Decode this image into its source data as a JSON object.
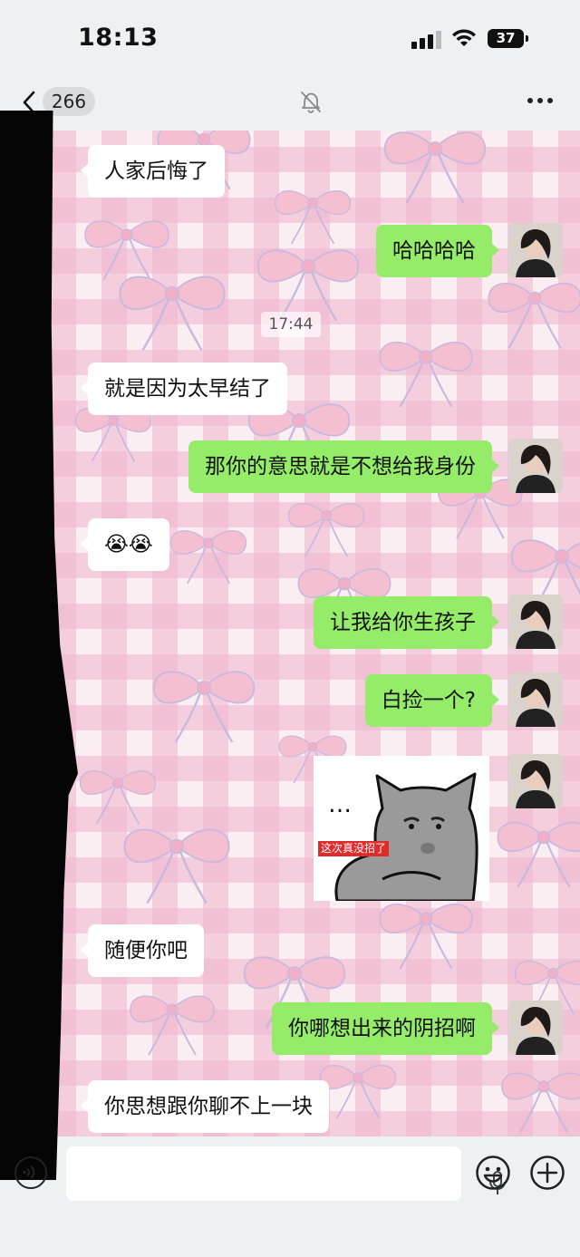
{
  "status_bar": {
    "time": "18:13",
    "battery": "37"
  },
  "nav": {
    "unread_count": "266"
  },
  "messages": [
    {
      "side": "in",
      "text": "人家后悔了"
    },
    {
      "side": "out",
      "text": "哈哈哈哈"
    },
    {
      "type": "time",
      "text": "17:44"
    },
    {
      "side": "in",
      "text": "就是因为太早结了"
    },
    {
      "side": "out",
      "text": "那你的意思就是不想给我身份"
    },
    {
      "side": "in",
      "text": "😭😭"
    },
    {
      "side": "out",
      "text": "让我给你生孩子"
    },
    {
      "side": "out",
      "text": "白捡一个?"
    },
    {
      "side": "out",
      "type": "sticker",
      "dots": "…",
      "caption": "这次真没招了"
    },
    {
      "side": "in",
      "text": "随便你吧"
    },
    {
      "side": "out",
      "text": "你哪想出来的阴招啊"
    },
    {
      "side": "in",
      "text": "你思想跟你聊不上一块"
    }
  ],
  "colors": {
    "outgoing_bubble": "#95ec69",
    "incoming_bubble": "#ffffff",
    "wallpaper_pink": "#f4c3d4",
    "bow_pink": "#f2b6cb"
  },
  "icons": {
    "back": "chevron-left-icon",
    "mute": "bell-slash-icon",
    "more": "more-dots-icon",
    "voice": "voice-icon",
    "mic": "microphone-icon",
    "emoji": "emoji-icon",
    "plus": "plus-icon"
  }
}
